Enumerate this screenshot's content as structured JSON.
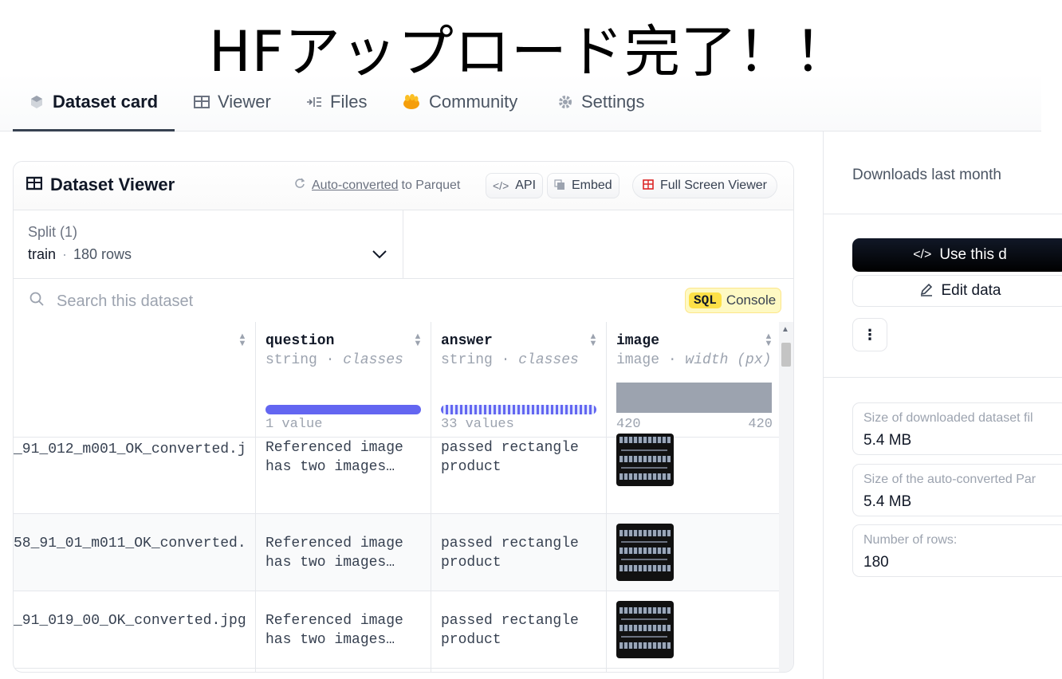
{
  "overlay": {
    "title": "HFアップロード完了！！"
  },
  "tabs": [
    {
      "label": "Dataset card",
      "icon": "cube-icon",
      "active": true
    },
    {
      "label": "Viewer",
      "icon": "table-icon"
    },
    {
      "label": "Files",
      "icon": "files-icon"
    },
    {
      "label": "Community",
      "icon": "hand-icon"
    },
    {
      "label": "Settings",
      "icon": "gear-icon"
    }
  ],
  "viewer": {
    "title": "Dataset Viewer",
    "auto_converted_link": "Auto-converted",
    "auto_converted_rest": "to Parquet",
    "api_label": "API",
    "embed_label": "Embed",
    "fullscreen_label": "Full Screen Viewer",
    "split": {
      "label": "Split (1)",
      "name": "train",
      "rows": "180 rows"
    },
    "search_placeholder": "Search this dataset",
    "sql": {
      "tag": "SQL",
      "label": "Console"
    },
    "columns": [
      {
        "name": "",
        "type": ""
      },
      {
        "name": "question",
        "type": "string",
        "type_extra": "classes",
        "footer_left": "1 value",
        "footer_right": "",
        "bar_color": "#6366f1"
      },
      {
        "name": "answer",
        "type": "string",
        "type_extra": "classes",
        "footer_left": "33 values",
        "footer_right": "",
        "bar_color": "#6366f1"
      },
      {
        "name": "image",
        "type": "image",
        "type_extra": "width (px)",
        "footer_left": "420",
        "footer_right": "420",
        "bar_color": "#9ca3af"
      }
    ],
    "rows": [
      {
        "file": "_91_012_m001_OK_converted.j",
        "question": "Referenced image\nhas two images…",
        "answer": "passed rectangle\nproduct"
      },
      {
        "file": "58_91_01_m011_OK_converted.",
        "question": "Referenced image\nhas two images…",
        "answer": "passed rectangle\nproduct"
      },
      {
        "file": "_91_019_00_OK_converted.jpg",
        "question": "Referenced image\nhas two images…",
        "answer": "passed rectangle\nproduct"
      }
    ]
  },
  "side": {
    "downloads_label": "Downloads last month",
    "use_label": "Use this d",
    "edit_label": "Edit data",
    "more_label": "⋮",
    "stats": [
      {
        "key": "Size of downloaded dataset fil",
        "value": "5.4 MB"
      },
      {
        "key": "Size of the auto-converted Par",
        "value": "5.4 MB"
      },
      {
        "key": "Number of rows:",
        "value": "180"
      }
    ]
  },
  "colors": {
    "accent_bar": "#6366f1",
    "sql_yellow": "#fde047",
    "fullscreen_icon": "#dc2626"
  }
}
